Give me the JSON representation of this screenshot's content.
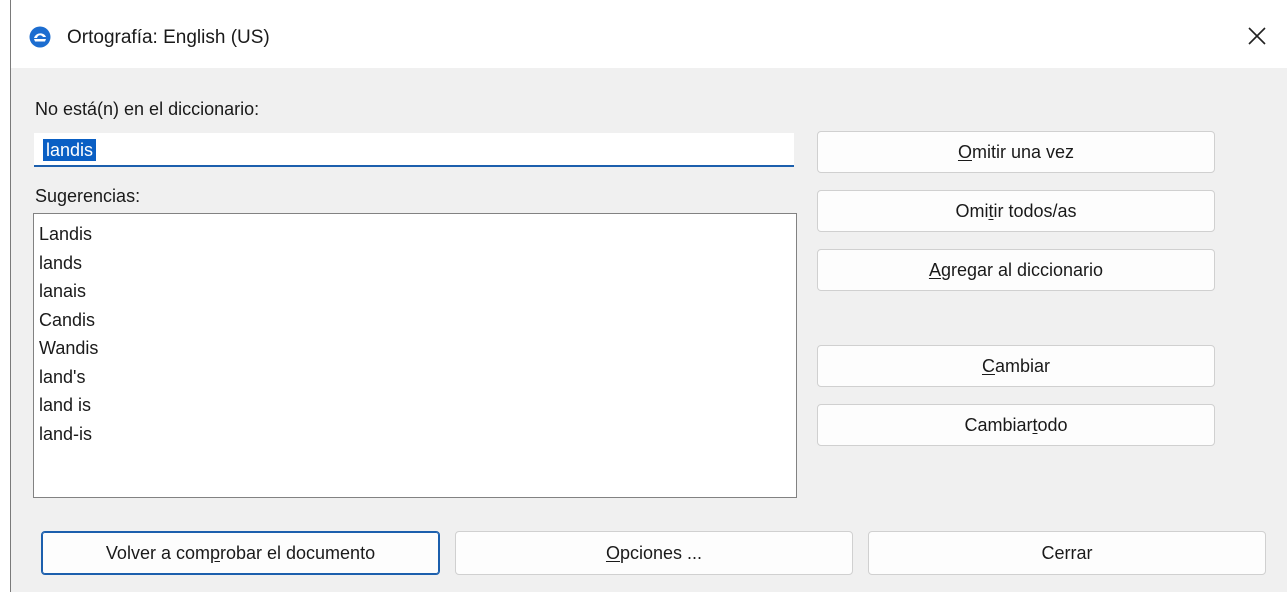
{
  "window": {
    "title": "Ortografía: English (US)",
    "app_icon": "blue-circle-logo-icon",
    "close_icon": "close-icon"
  },
  "not_in_dictionary": {
    "label": "No está(n) en el diccionario:",
    "value": "landis"
  },
  "suggestions": {
    "label": "Sugerencias:",
    "items": [
      "Landis",
      "lands",
      "lanais",
      "Candis",
      "Wandis",
      "land's",
      "land is",
      "land-is"
    ]
  },
  "buttons": {
    "ignore_once": {
      "pre": "",
      "mnemonic": "O",
      "post": "mitir una vez"
    },
    "ignore_all": {
      "pre": "Omi",
      "mnemonic": "t",
      "post": "ir todos/as"
    },
    "add_to_dictionary": {
      "pre": "",
      "mnemonic": "A",
      "post": "gregar al diccionario"
    },
    "change": {
      "pre": "",
      "mnemonic": "C",
      "post": "ambiar"
    },
    "change_all": {
      "pre": "Cambiar ",
      "mnemonic": "t",
      "post": "odo"
    },
    "recheck": {
      "pre": "Volver a com",
      "mnemonic": "p",
      "post": "robar el documento"
    },
    "options": {
      "pre": "",
      "mnemonic": "O",
      "post": "pciones ..."
    },
    "close": {
      "pre": "",
      "mnemonic": "",
      "post": "Cerrar"
    }
  },
  "colors": {
    "accent": "#1c5fad",
    "selection": "#0a5fc4",
    "dialog_bg": "#f0f0f0"
  }
}
